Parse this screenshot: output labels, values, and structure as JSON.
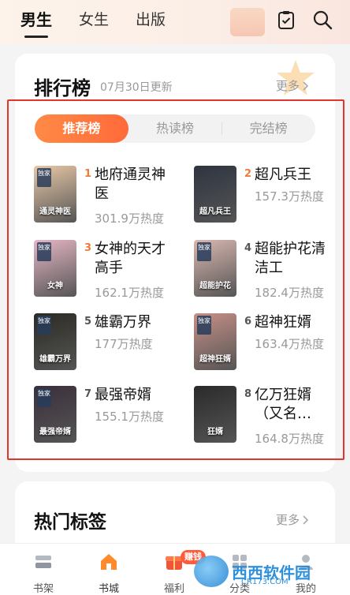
{
  "header": {
    "tabs": [
      {
        "label": "男生",
        "active": true
      },
      {
        "label": "女生",
        "active": false
      },
      {
        "label": "出版",
        "active": false
      }
    ],
    "icons": [
      "checkin-icon",
      "search-icon"
    ]
  },
  "ranking": {
    "title": "排行榜",
    "updated": "07月30日更新",
    "more": "更多",
    "tabs": [
      {
        "label": "推荐榜",
        "active": true
      },
      {
        "label": "热读榜",
        "active": false
      },
      {
        "label": "完结榜",
        "active": false
      }
    ],
    "books": [
      {
        "rank": "1",
        "name": "地府通灵神医",
        "heat": "301.9万热度",
        "cover_text": "通灵神医",
        "exclusive": true,
        "rank_color": "#f07a3a",
        "cover_color": "#e9c8a6"
      },
      {
        "rank": "2",
        "name": "超凡兵王",
        "heat": "157.3万热度",
        "cover_text": "超凡兵王",
        "exclusive": false,
        "rank_color": "#f07a3a",
        "cover_color": "#2e3440"
      },
      {
        "rank": "3",
        "name": "女神的天才高手",
        "heat": "162.1万热度",
        "cover_text": "女神",
        "exclusive": true,
        "rank_color": "#f07a3a",
        "cover_color": "#e6b6c4"
      },
      {
        "rank": "4",
        "name": "超能护花清洁工",
        "heat": "182.4万热度",
        "cover_text": "超能护花",
        "exclusive": true,
        "rank_color": "#555555",
        "cover_color": "#d9b7b0"
      },
      {
        "rank": "5",
        "name": "雄霸万界",
        "heat": "177万热度",
        "cover_text": "雄霸万界",
        "exclusive": true,
        "rank_color": "#555555",
        "cover_color": "#2b2a22"
      },
      {
        "rank": "6",
        "name": "超神狂婿",
        "heat": "163.4万热度",
        "cover_text": "超神狂婿",
        "exclusive": true,
        "rank_color": "#555555",
        "cover_color": "#c78f86"
      },
      {
        "rank": "7",
        "name": "最强帝婿",
        "heat": "155.1万热度",
        "cover_text": "最强帝婿",
        "exclusive": true,
        "rank_color": "#555555",
        "cover_color": "#3a2f3a"
      },
      {
        "rank": "8",
        "name": "亿万狂婿（又名…",
        "heat": "164.8万热度",
        "cover_text": "狂婿",
        "exclusive": false,
        "rank_color": "#555555",
        "cover_color": "#2a2a2a"
      }
    ]
  },
  "tags": {
    "title": "热门标签",
    "more": "更多"
  },
  "bottom_nav": [
    {
      "label": "书架",
      "icon": "bookshelf-icon",
      "active": false
    },
    {
      "label": "书城",
      "icon": "bookstore-home-icon",
      "active": true
    },
    {
      "label": "福利",
      "icon": "gift-icon",
      "active": false
    },
    {
      "label": "分类",
      "icon": "category-icon",
      "active": false
    },
    {
      "label": "我的",
      "icon": "profile-icon",
      "active": false
    }
  ],
  "badge": {
    "earn": "赚钱"
  },
  "watermark": {
    "text": "西西软件园",
    "sub": "CR173.COM"
  },
  "colors": {
    "accent": "#ff6a3a",
    "frame": "#e2352d"
  }
}
